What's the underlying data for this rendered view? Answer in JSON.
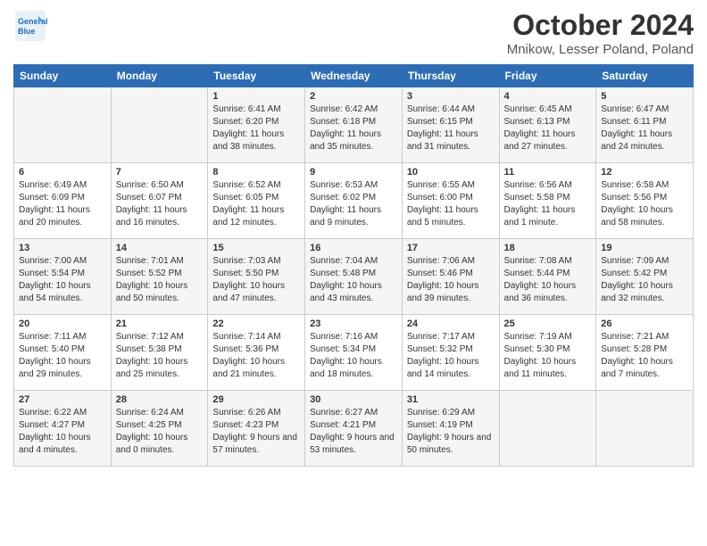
{
  "logo": {
    "line1": "General",
    "line2": "Blue"
  },
  "title": "October 2024",
  "location": "Mnikow, Lesser Poland, Poland",
  "days_of_week": [
    "Sunday",
    "Monday",
    "Tuesday",
    "Wednesday",
    "Thursday",
    "Friday",
    "Saturday"
  ],
  "weeks": [
    [
      {
        "day": "",
        "sunrise": "",
        "sunset": "",
        "daylight": ""
      },
      {
        "day": "",
        "sunrise": "",
        "sunset": "",
        "daylight": ""
      },
      {
        "day": "1",
        "sunrise": "Sunrise: 6:41 AM",
        "sunset": "Sunset: 6:20 PM",
        "daylight": "Daylight: 11 hours and 38 minutes."
      },
      {
        "day": "2",
        "sunrise": "Sunrise: 6:42 AM",
        "sunset": "Sunset: 6:18 PM",
        "daylight": "Daylight: 11 hours and 35 minutes."
      },
      {
        "day": "3",
        "sunrise": "Sunrise: 6:44 AM",
        "sunset": "Sunset: 6:15 PM",
        "daylight": "Daylight: 11 hours and 31 minutes."
      },
      {
        "day": "4",
        "sunrise": "Sunrise: 6:45 AM",
        "sunset": "Sunset: 6:13 PM",
        "daylight": "Daylight: 11 hours and 27 minutes."
      },
      {
        "day": "5",
        "sunrise": "Sunrise: 6:47 AM",
        "sunset": "Sunset: 6:11 PM",
        "daylight": "Daylight: 11 hours and 24 minutes."
      }
    ],
    [
      {
        "day": "6",
        "sunrise": "Sunrise: 6:49 AM",
        "sunset": "Sunset: 6:09 PM",
        "daylight": "Daylight: 11 hours and 20 minutes."
      },
      {
        "day": "7",
        "sunrise": "Sunrise: 6:50 AM",
        "sunset": "Sunset: 6:07 PM",
        "daylight": "Daylight: 11 hours and 16 minutes."
      },
      {
        "day": "8",
        "sunrise": "Sunrise: 6:52 AM",
        "sunset": "Sunset: 6:05 PM",
        "daylight": "Daylight: 11 hours and 12 minutes."
      },
      {
        "day": "9",
        "sunrise": "Sunrise: 6:53 AM",
        "sunset": "Sunset: 6:02 PM",
        "daylight": "Daylight: 11 hours and 9 minutes."
      },
      {
        "day": "10",
        "sunrise": "Sunrise: 6:55 AM",
        "sunset": "Sunset: 6:00 PM",
        "daylight": "Daylight: 11 hours and 5 minutes."
      },
      {
        "day": "11",
        "sunrise": "Sunrise: 6:56 AM",
        "sunset": "Sunset: 5:58 PM",
        "daylight": "Daylight: 11 hours and 1 minute."
      },
      {
        "day": "12",
        "sunrise": "Sunrise: 6:58 AM",
        "sunset": "Sunset: 5:56 PM",
        "daylight": "Daylight: 10 hours and 58 minutes."
      }
    ],
    [
      {
        "day": "13",
        "sunrise": "Sunrise: 7:00 AM",
        "sunset": "Sunset: 5:54 PM",
        "daylight": "Daylight: 10 hours and 54 minutes."
      },
      {
        "day": "14",
        "sunrise": "Sunrise: 7:01 AM",
        "sunset": "Sunset: 5:52 PM",
        "daylight": "Daylight: 10 hours and 50 minutes."
      },
      {
        "day": "15",
        "sunrise": "Sunrise: 7:03 AM",
        "sunset": "Sunset: 5:50 PM",
        "daylight": "Daylight: 10 hours and 47 minutes."
      },
      {
        "day": "16",
        "sunrise": "Sunrise: 7:04 AM",
        "sunset": "Sunset: 5:48 PM",
        "daylight": "Daylight: 10 hours and 43 minutes."
      },
      {
        "day": "17",
        "sunrise": "Sunrise: 7:06 AM",
        "sunset": "Sunset: 5:46 PM",
        "daylight": "Daylight: 10 hours and 39 minutes."
      },
      {
        "day": "18",
        "sunrise": "Sunrise: 7:08 AM",
        "sunset": "Sunset: 5:44 PM",
        "daylight": "Daylight: 10 hours and 36 minutes."
      },
      {
        "day": "19",
        "sunrise": "Sunrise: 7:09 AM",
        "sunset": "Sunset: 5:42 PM",
        "daylight": "Daylight: 10 hours and 32 minutes."
      }
    ],
    [
      {
        "day": "20",
        "sunrise": "Sunrise: 7:11 AM",
        "sunset": "Sunset: 5:40 PM",
        "daylight": "Daylight: 10 hours and 29 minutes."
      },
      {
        "day": "21",
        "sunrise": "Sunrise: 7:12 AM",
        "sunset": "Sunset: 5:38 PM",
        "daylight": "Daylight: 10 hours and 25 minutes."
      },
      {
        "day": "22",
        "sunrise": "Sunrise: 7:14 AM",
        "sunset": "Sunset: 5:36 PM",
        "daylight": "Daylight: 10 hours and 21 minutes."
      },
      {
        "day": "23",
        "sunrise": "Sunrise: 7:16 AM",
        "sunset": "Sunset: 5:34 PM",
        "daylight": "Daylight: 10 hours and 18 minutes."
      },
      {
        "day": "24",
        "sunrise": "Sunrise: 7:17 AM",
        "sunset": "Sunset: 5:32 PM",
        "daylight": "Daylight: 10 hours and 14 minutes."
      },
      {
        "day": "25",
        "sunrise": "Sunrise: 7:19 AM",
        "sunset": "Sunset: 5:30 PM",
        "daylight": "Daylight: 10 hours and 11 minutes."
      },
      {
        "day": "26",
        "sunrise": "Sunrise: 7:21 AM",
        "sunset": "Sunset: 5:28 PM",
        "daylight": "Daylight: 10 hours and 7 minutes."
      }
    ],
    [
      {
        "day": "27",
        "sunrise": "Sunrise: 6:22 AM",
        "sunset": "Sunset: 4:27 PM",
        "daylight": "Daylight: 10 hours and 4 minutes."
      },
      {
        "day": "28",
        "sunrise": "Sunrise: 6:24 AM",
        "sunset": "Sunset: 4:25 PM",
        "daylight": "Daylight: 10 hours and 0 minutes."
      },
      {
        "day": "29",
        "sunrise": "Sunrise: 6:26 AM",
        "sunset": "Sunset: 4:23 PM",
        "daylight": "Daylight: 9 hours and 57 minutes."
      },
      {
        "day": "30",
        "sunrise": "Sunrise: 6:27 AM",
        "sunset": "Sunset: 4:21 PM",
        "daylight": "Daylight: 9 hours and 53 minutes."
      },
      {
        "day": "31",
        "sunrise": "Sunrise: 6:29 AM",
        "sunset": "Sunset: 4:19 PM",
        "daylight": "Daylight: 9 hours and 50 minutes."
      },
      {
        "day": "",
        "sunrise": "",
        "sunset": "",
        "daylight": ""
      },
      {
        "day": "",
        "sunrise": "",
        "sunset": "",
        "daylight": ""
      }
    ]
  ]
}
